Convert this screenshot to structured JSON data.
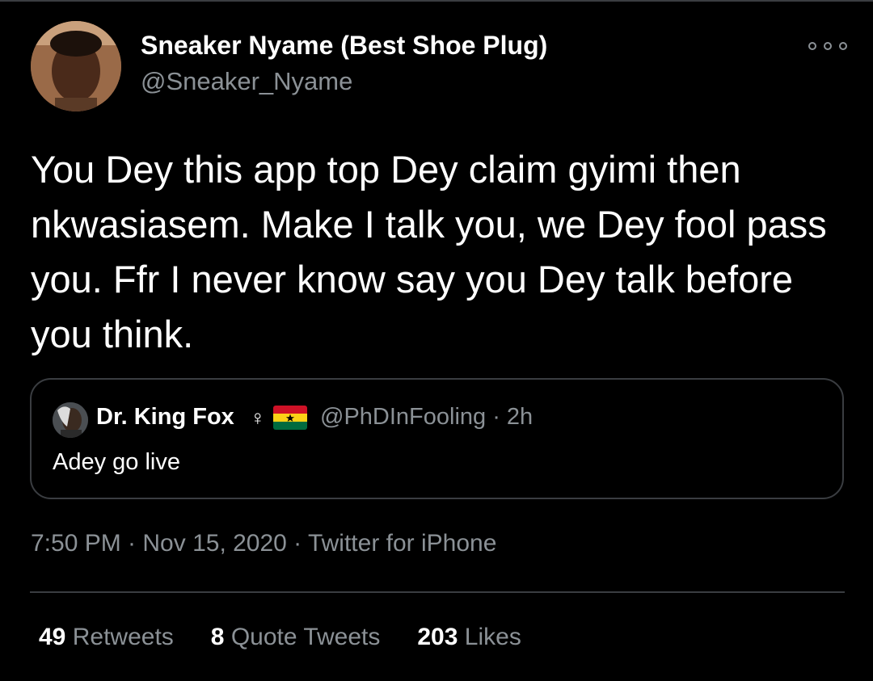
{
  "tweet": {
    "author_name": "Sneaker Nyame (Best Shoe Plug)",
    "author_handle": "@Sneaker_Nyame",
    "more_icon": "more-options-icon",
    "text": "You Dey this app top Dey claim gyimi then nkwasiasem. Make I talk you, we Dey fool pass you. Ffr I never know say you Dey talk before you think.",
    "quoted": {
      "name": "Dr. King Fox",
      "female_sign": "♀",
      "flag_icon": "ghana-flag-icon",
      "handle_time": "@PhDInFooling · 2h",
      "text": "Adey go live"
    },
    "meta": "7:50 PM · Nov 15, 2020 · Twitter for iPhone",
    "stats": {
      "retweets": {
        "count": "49",
        "label": "Retweets"
      },
      "quotes": {
        "count": "8",
        "label": "Quote Tweets"
      },
      "likes": {
        "count": "203",
        "label": "Likes"
      }
    }
  },
  "colors": {
    "background": "#000000",
    "primary_text": "#ffffff",
    "secondary_text": "#8b9196",
    "border": "#3a3d41"
  }
}
